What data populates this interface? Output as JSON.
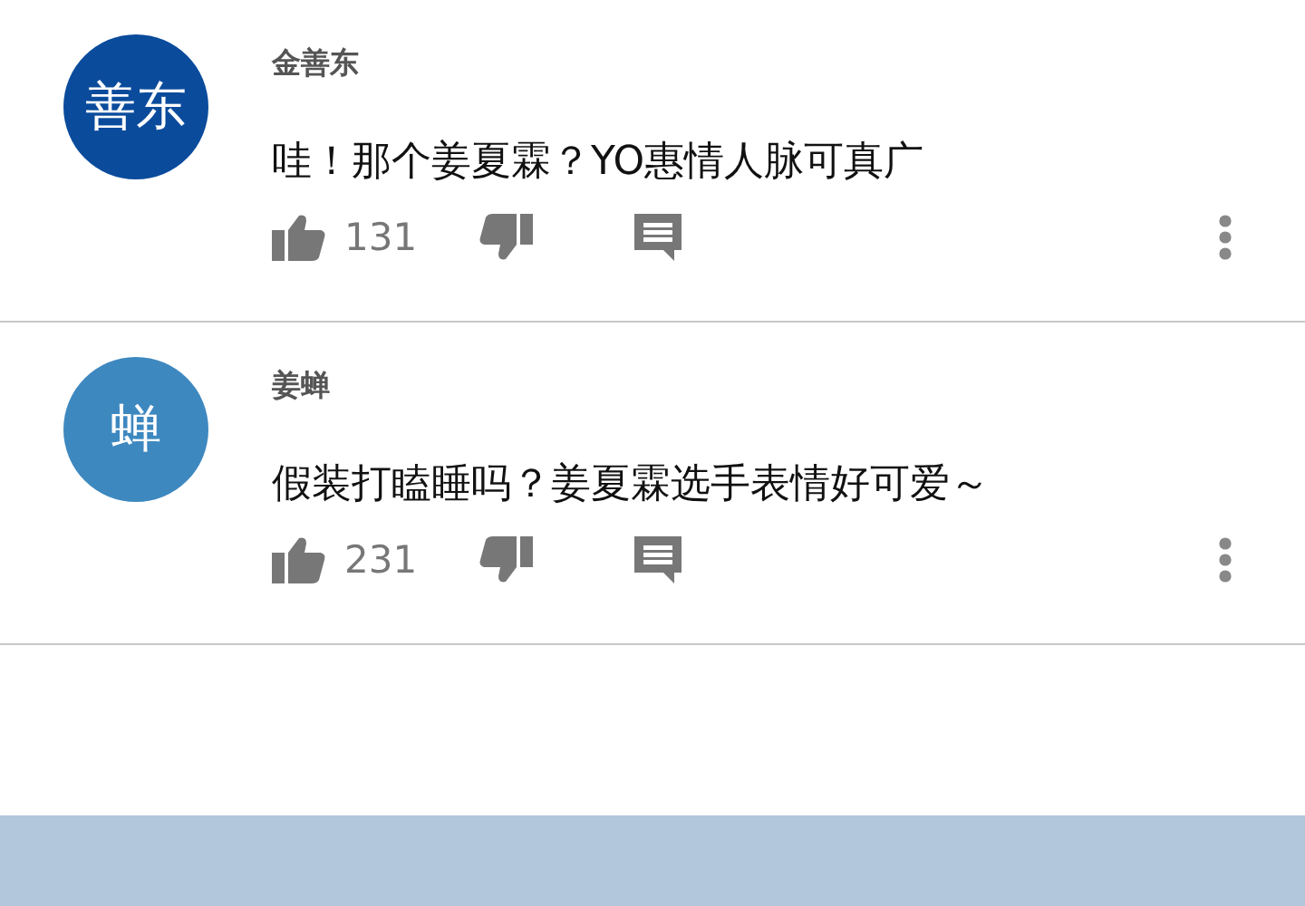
{
  "comments": [
    {
      "avatar_text": "善东",
      "color": "#0a4b9c",
      "author": "金善东",
      "text": "哇！那个姜夏霖？YO惠情人脉可真广",
      "likes": "131"
    },
    {
      "avatar_text": "蝉",
      "color": "#3e88c0",
      "author": "姜蝉",
      "text": "假装打瞌睡吗？姜夏霖选手表情好可爱～",
      "likes": "231"
    }
  ]
}
